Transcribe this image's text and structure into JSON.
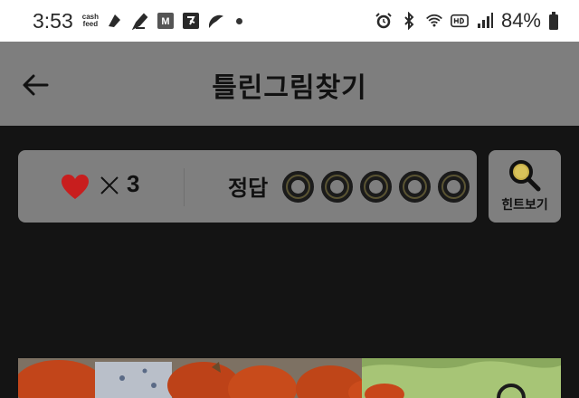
{
  "status_bar": {
    "time": "3:53",
    "cashfeed_top": "cash",
    "cashfeed_bottom": "feed",
    "m_icon_label": "M",
    "battery": "84%",
    "left_icons": [
      "pen-icon",
      "pencil-icon",
      "m-app-icon",
      "letter-app-icon",
      "leaf-icon",
      "dot-icon"
    ],
    "right_icons": [
      "alarm-icon",
      "bluetooth-icon",
      "wifi-icon",
      "hd-icon",
      "signal-icon",
      "battery-icon"
    ]
  },
  "app_bar": {
    "title": "틀린그림찾기",
    "back_icon": "arrow-left-icon"
  },
  "game_info": {
    "lives": "3",
    "answer_label": "정답",
    "answer_slots": 5,
    "answers_found": 0
  },
  "hint_button": {
    "label": "힌트보기",
    "icon": "magnifier-icon"
  },
  "colors": {
    "status_bar_bg": "#ffffff",
    "app_bar_bg": "#7e7e7e",
    "page_bg": "#141414",
    "panel_bg": "#7f7f7f",
    "heart": "#c81e1e",
    "circle_gold": "#5a5433"
  }
}
